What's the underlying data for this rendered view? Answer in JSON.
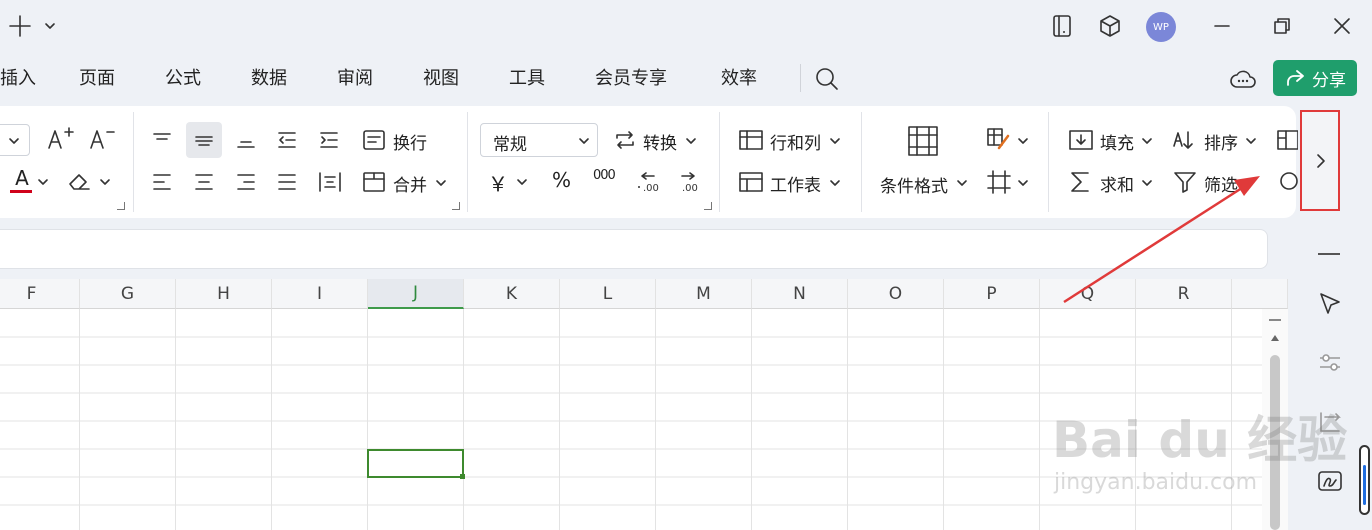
{
  "titlebar": {
    "new_tab_icon": "plus-icon",
    "avatar_text": "WP",
    "icons": [
      "tablet-icon",
      "cube-icon",
      "minimize-icon",
      "restore-icon",
      "close-icon"
    ]
  },
  "menu": {
    "tabs": [
      "插入",
      "页面",
      "公式",
      "数据",
      "审阅",
      "视图",
      "工具",
      "会员专享",
      "效率"
    ],
    "share_label": "分享"
  },
  "ribbon": {
    "wrap_text": "换行",
    "merge": "合并",
    "number_format": "常规",
    "convert": "转换",
    "rows_cols": "行和列",
    "worksheet": "工作表",
    "conditional_format": "条件格式",
    "fill": "填充",
    "sort": "排序",
    "sum": "求和",
    "filter": "筛选",
    "currency_symbol": "￥",
    "percent_symbol": "%",
    "thousands_symbol": "000",
    "font_color_letter": "A",
    "font_color_accent": "#d0021b"
  },
  "sheet": {
    "columns": [
      "F",
      "G",
      "H",
      "I",
      "J",
      "K",
      "L",
      "M",
      "N",
      "O",
      "P",
      "Q",
      "R"
    ],
    "active_column": "J",
    "selection_color": "#3e8a2e"
  },
  "watermark": {
    "line1": "Bai du 经验",
    "line2": "jingyan.baidu.com"
  },
  "annotation": {
    "color": "#e03a3a"
  }
}
